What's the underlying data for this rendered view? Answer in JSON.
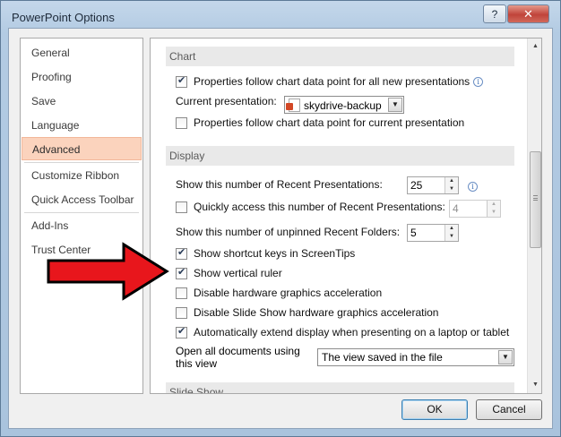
{
  "window": {
    "title": "PowerPoint Options",
    "help_label": "?",
    "close_label": "✕"
  },
  "nav": {
    "items": [
      {
        "label": "General"
      },
      {
        "label": "Proofing"
      },
      {
        "label": "Save"
      },
      {
        "label": "Language"
      },
      {
        "label": "Advanced",
        "selected": true
      },
      {
        "label": "Customize Ribbon"
      },
      {
        "label": "Quick Access Toolbar"
      },
      {
        "label": "Add-Ins"
      },
      {
        "label": "Trust Center"
      }
    ]
  },
  "chart_section": {
    "header": "Chart",
    "follow_all_label": "Properties follow chart data point for all new presentations",
    "follow_all_checked": true,
    "current_pres_label": "Current presentation:",
    "current_pres_value": "skydrive-backup",
    "follow_current_label": "Properties follow chart data point for current presentation",
    "follow_current_checked": false
  },
  "display_section": {
    "header": "Display",
    "recent_label": "Show this number of Recent Presentations:",
    "recent_value": "25",
    "quick_access_label": "Quickly access this number of Recent Presentations:",
    "quick_access_value": "4",
    "quick_access_checked": false,
    "unpinned_label": "Show this number of unpinned Recent Folders:",
    "unpinned_value": "5",
    "shortcut_keys_label": "Show shortcut keys in ScreenTips",
    "shortcut_keys_checked": true,
    "vertical_ruler_label": "Show vertical ruler",
    "vertical_ruler_checked": true,
    "hw_accel_label": "Disable hardware graphics acceleration",
    "hw_accel_checked": false,
    "slideshow_hw_label": "Disable Slide Show hardware graphics acceleration",
    "slideshow_hw_checked": false,
    "extend_display_label": "Automatically extend display when presenting on a laptop or tablet",
    "extend_display_checked": true,
    "open_docs_label_line1": "Open all documents using",
    "open_docs_label_line2": "this view",
    "open_docs_value": "The view saved in the file"
  },
  "slideshow_section": {
    "header": "Slide Show"
  },
  "footer": {
    "ok_label": "OK",
    "cancel_label": "Cancel"
  },
  "annotation": {
    "arrow_color": "#e8161c",
    "arrow_outline": "#000000"
  },
  "icons": {
    "info": "info-icon",
    "presentation": "powerpoint-file-icon",
    "dropdown": "chevron-down-icon",
    "spin": "spin-arrows-icon"
  }
}
